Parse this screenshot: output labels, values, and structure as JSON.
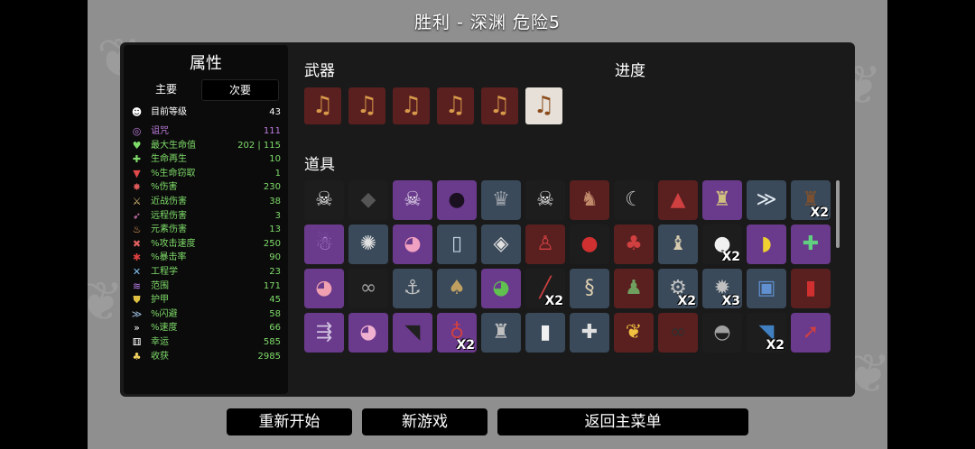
{
  "title": "胜利 - 深渊    危险5",
  "colors": {
    "purple": "#6a3a8c",
    "dark": "#1d1d1d",
    "red": "#5a1f1f",
    "slate": "#3a4a5a",
    "green_text": "#7fdc6a",
    "purple_text": "#c07ee0"
  },
  "stats": {
    "heading": "属性",
    "tab_main": "主要",
    "tab_secondary": "次要",
    "rows": [
      {
        "icon": "level-icon",
        "glyph": "☻",
        "label": "目前等级",
        "value": "43",
        "color": "#ffffff",
        "icolor": "#ffffff"
      },
      {
        "icon": "curse-icon",
        "glyph": "◎",
        "label": "诅咒",
        "value": "111",
        "color": "#c07ee0",
        "icolor": "#c07ee0"
      },
      {
        "icon": "max-hp-icon",
        "glyph": "♥",
        "label": "最大生命值",
        "value": "202 | 115",
        "color": "#7fdc6a",
        "icolor": "#7fdc6a"
      },
      {
        "icon": "hp-regen-icon",
        "glyph": "✚",
        "label": "生命再生",
        "value": "10",
        "color": "#7fdc6a",
        "icolor": "#7fdc6a"
      },
      {
        "icon": "life-steal-icon",
        "glyph": "▼",
        "label": "%生命窃取",
        "value": "1",
        "color": "#7fdc6a",
        "icolor": "#e04a4a"
      },
      {
        "icon": "damage-icon",
        "glyph": "✸",
        "label": "%伤害",
        "value": "230",
        "color": "#7fdc6a",
        "icolor": "#e05a5a"
      },
      {
        "icon": "melee-icon",
        "glyph": "⚔",
        "label": "近战伤害",
        "value": "38",
        "color": "#7fdc6a",
        "icolor": "#e0c07a"
      },
      {
        "icon": "ranged-icon",
        "glyph": "➶",
        "label": "远程伤害",
        "value": "3",
        "color": "#7fdc6a",
        "icolor": "#e080c0"
      },
      {
        "icon": "elemental-icon",
        "glyph": "♨",
        "label": "元素伤害",
        "value": "13",
        "color": "#7fdc6a",
        "icolor": "#f0a060"
      },
      {
        "icon": "attack-speed-icon",
        "glyph": "✖",
        "label": "%攻击速度",
        "value": "250",
        "color": "#7fdc6a",
        "icolor": "#e06060"
      },
      {
        "icon": "crit-icon",
        "glyph": "✱",
        "label": "%暴击率",
        "value": "90",
        "color": "#7fdc6a",
        "icolor": "#e04040"
      },
      {
        "icon": "engineering-icon",
        "glyph": "✕",
        "label": "工程学",
        "value": "23",
        "color": "#7fdc6a",
        "icolor": "#80c0f0"
      },
      {
        "icon": "range-icon",
        "glyph": "≋",
        "label": "范围",
        "value": "171",
        "color": "#7fdc6a",
        "icolor": "#c080f0"
      },
      {
        "icon": "armor-icon",
        "glyph": "⛊",
        "label": "护甲",
        "value": "45",
        "color": "#7fdc6a",
        "icolor": "#e0c040"
      },
      {
        "icon": "dodge-icon",
        "glyph": "≫",
        "label": "%闪避",
        "value": "58",
        "color": "#7fdc6a",
        "icolor": "#a0c0e0"
      },
      {
        "icon": "speed-icon",
        "glyph": "»",
        "label": "%速度",
        "value": "66",
        "color": "#7fdc6a",
        "icolor": "#ffffff"
      },
      {
        "icon": "luck-icon",
        "glyph": "⚅",
        "label": "幸运",
        "value": "585",
        "color": "#7fdc6a",
        "icolor": "#ffffff"
      },
      {
        "icon": "harvesting-icon",
        "glyph": "♣",
        "label": "收获",
        "value": "2985",
        "color": "#7fdc6a",
        "icolor": "#f0d060"
      }
    ]
  },
  "weapons": {
    "heading": "武器",
    "items": [
      {
        "name": "lute-icon",
        "selected": false
      },
      {
        "name": "lute-icon",
        "selected": false
      },
      {
        "name": "lute-icon",
        "selected": false
      },
      {
        "name": "lute-icon",
        "selected": false
      },
      {
        "name": "lute-icon",
        "selected": false
      },
      {
        "name": "lute-icon",
        "selected": true
      }
    ]
  },
  "progress_heading": "进度",
  "items_heading": "道具",
  "items": [
    {
      "icon": "hooded-ghost-icon",
      "glyph": "☠",
      "bg": "#1d1d1d",
      "fg": "#f0f0f0",
      "count": ""
    },
    {
      "icon": "coal-icon",
      "glyph": "◆",
      "bg": "#1d1d1d",
      "fg": "#555555",
      "count": ""
    },
    {
      "icon": "purple-skull-icon",
      "glyph": "☠",
      "bg": "#6a3a8c",
      "fg": "#e8e0f0",
      "count": ""
    },
    {
      "icon": "dark-orbs-icon",
      "glyph": "●",
      "bg": "#6a3a8c",
      "fg": "#1a1020",
      "count": ""
    },
    {
      "icon": "tiara-icon",
      "glyph": "♛",
      "bg": "#3a4a5a",
      "fg": "#9aa0a8",
      "count": ""
    },
    {
      "icon": "goat-skull-icon",
      "glyph": "☠",
      "bg": "#1d1d1d",
      "fg": "#f0f0f0",
      "count": ""
    },
    {
      "icon": "mammoth-icon",
      "glyph": "♞",
      "bg": "#5a1f1f",
      "fg": "#c08a6a",
      "count": ""
    },
    {
      "icon": "scythe-icon",
      "glyph": "☾",
      "bg": "#1d1d1d",
      "fg": "#c0c0c0",
      "count": ""
    },
    {
      "icon": "red-cape-icon",
      "glyph": "▲",
      "bg": "#5a1f1f",
      "fg": "#d04040",
      "count": ""
    },
    {
      "icon": "broken-bust-icon",
      "glyph": "♜",
      "bg": "#6a3a8c",
      "fg": "#d0c080",
      "count": ""
    },
    {
      "icon": "claw-slash-icon",
      "glyph": "≫",
      "bg": "#3a4a5a",
      "fg": "#e0e8f0",
      "count": ""
    },
    {
      "icon": "stump-icon",
      "glyph": "♜",
      "bg": "#3a4a5a",
      "fg": "#7a5030",
      "count": "X2"
    },
    {
      "icon": "purple-ghost-icon",
      "glyph": "☃",
      "bg": "#6a3a8c",
      "fg": "#b080d0",
      "count": ""
    },
    {
      "icon": "spiked-ring-icon",
      "glyph": "✺",
      "bg": "#3a4a5a",
      "fg": "#e0e0e0",
      "count": ""
    },
    {
      "icon": "pink-blob-icon",
      "glyph": "◕",
      "bg": "#6a3a8c",
      "fg": "#f0a0c0",
      "count": ""
    },
    {
      "icon": "mirror-icon",
      "glyph": "▯",
      "bg": "#3a4a5a",
      "fg": "#c0d0e0",
      "count": ""
    },
    {
      "icon": "eraser-icon",
      "glyph": "◈",
      "bg": "#3a4a5a",
      "fg": "#e0e0e0",
      "count": ""
    },
    {
      "icon": "gnome-icon",
      "glyph": "♙",
      "bg": "#5a1f1f",
      "fg": "#d04040",
      "count": ""
    },
    {
      "icon": "boxing-glove-icon",
      "glyph": "●",
      "bg": "#1d1d1d",
      "fg": "#d03030",
      "count": ""
    },
    {
      "icon": "red-shirt-icon",
      "glyph": "♣",
      "bg": "#5a1f1f",
      "fg": "#d04040",
      "count": ""
    },
    {
      "icon": "stone-statue-icon",
      "glyph": "♝",
      "bg": "#3a4a5a",
      "fg": "#d8ccb0",
      "count": ""
    },
    {
      "icon": "snowball-icon",
      "glyph": "●",
      "bg": "#1d1d1d",
      "fg": "#f0f0f0",
      "count": "X2"
    },
    {
      "icon": "rubber-duck-icon",
      "glyph": "◗",
      "bg": "#6a3a8c",
      "fg": "#f0d030",
      "count": ""
    },
    {
      "icon": "medical-kit-icon",
      "glyph": "✚",
      "bg": "#6a3a8c",
      "fg": "#60d080",
      "count": ""
    },
    {
      "icon": "piggy-bank-icon",
      "glyph": "◕",
      "bg": "#6a3a8c",
      "fg": "#f0a0b0",
      "count": ""
    },
    {
      "icon": "handcuffs-icon",
      "glyph": "∞",
      "bg": "#1d1d1d",
      "fg": "#a0a0a0",
      "count": ""
    },
    {
      "icon": "fishing-hook-icon",
      "glyph": "⚓",
      "bg": "#3a4a5a",
      "fg": "#c0c0c0",
      "count": ""
    },
    {
      "icon": "mushroom-icon",
      "glyph": "♠",
      "bg": "#3a4a5a",
      "fg": "#c0a060",
      "count": ""
    },
    {
      "icon": "frog-icon",
      "glyph": "◕",
      "bg": "#6a3a8c",
      "fg": "#60c050",
      "count": ""
    },
    {
      "icon": "red-stick-icon",
      "glyph": "╱",
      "bg": "#1d1d1d",
      "fg": "#d04040",
      "count": "X2"
    },
    {
      "icon": "rope-icon",
      "glyph": "§",
      "bg": "#3a4a5a",
      "fg": "#e0d0b0",
      "count": ""
    },
    {
      "icon": "vampire-icon",
      "glyph": "♟",
      "bg": "#5a1f1f",
      "fg": "#70a060",
      "count": ""
    },
    {
      "icon": "turret-icon",
      "glyph": "⚙",
      "bg": "#3a4a5a",
      "fg": "#c0c0c0",
      "count": "X2"
    },
    {
      "icon": "landmine-icon",
      "glyph": "✹",
      "bg": "#3a4a5a",
      "fg": "#c0c0c0",
      "count": "X3"
    },
    {
      "icon": "jar-icon",
      "glyph": "▣",
      "bg": "#3a4a5a",
      "fg": "#6090d0",
      "count": ""
    },
    {
      "icon": "ketchup-icon",
      "glyph": "▮",
      "bg": "#5a1f1f",
      "fg": "#d03030",
      "count": ""
    },
    {
      "icon": "arrows-icon",
      "glyph": "⇶",
      "bg": "#6a3a8c",
      "fg": "#d0c0e0",
      "count": ""
    },
    {
      "icon": "pink-slime-icon",
      "glyph": "◕",
      "bg": "#6a3a8c",
      "fg": "#f0b0d0",
      "count": ""
    },
    {
      "icon": "scarf-icon",
      "glyph": "◥",
      "bg": "#6a3a8c",
      "fg": "#202020",
      "count": ""
    },
    {
      "icon": "potion-icon",
      "glyph": "♁",
      "bg": "#6a3a8c",
      "fg": "#d04040",
      "count": "X2"
    },
    {
      "icon": "sandcastle-icon",
      "glyph": "♜",
      "bg": "#3a4a5a",
      "fg": "#c0c0c0",
      "count": ""
    },
    {
      "icon": "milk-bottle-icon",
      "glyph": "▮",
      "bg": "#3a4a5a",
      "fg": "#f0f0f0",
      "count": ""
    },
    {
      "icon": "bone-icon",
      "glyph": "✚",
      "bg": "#3a4a5a",
      "fg": "#e0e0e0",
      "count": ""
    },
    {
      "icon": "rainbow-leaf-icon",
      "glyph": "❦",
      "bg": "#5a1f1f",
      "fg": "#f0c040",
      "count": ""
    },
    {
      "icon": "binoculars-icon",
      "glyph": "∞",
      "bg": "#5a1f1f",
      "fg": "#303030",
      "count": ""
    },
    {
      "icon": "helmet-icon",
      "glyph": "◓",
      "bg": "#1d1d1d",
      "fg": "#a0a0a0",
      "count": ""
    },
    {
      "icon": "fish-icon",
      "glyph": "◥",
      "bg": "#1d1d1d",
      "fg": "#4080c0",
      "count": "X2"
    },
    {
      "icon": "rocket-icon",
      "glyph": "➚",
      "bg": "#6a3a8c",
      "fg": "#d04040",
      "count": ""
    }
  ],
  "buttons": {
    "restart": "重新开始",
    "new_game": "新游戏",
    "main_menu": "返回主菜单"
  }
}
